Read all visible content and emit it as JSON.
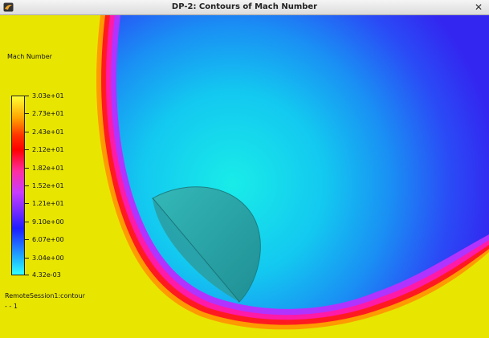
{
  "window": {
    "title": "DP-2: Contours of Mach Number",
    "close_glyph": "✕",
    "app_icon": "fluent-app-icon",
    "close_icon": "close-icon"
  },
  "legend": {
    "title": "Mach Number",
    "labels": [
      "3.03e+01",
      "2.73e+01",
      "2.43e+01",
      "2.12e+01",
      "1.82e+01",
      "1.52e+01",
      "1.21e+01",
      "9.10e+00",
      "6.07e+00",
      "3.04e+00",
      "4.32e-03"
    ]
  },
  "footer": {
    "session": "RemoteSession1:contour",
    "id": "- - 1"
  },
  "colors": {
    "freestream": "#e8e800",
    "shock": "#ff00c8",
    "body": "#2aa7a7",
    "wake": "#00d8f0"
  }
}
